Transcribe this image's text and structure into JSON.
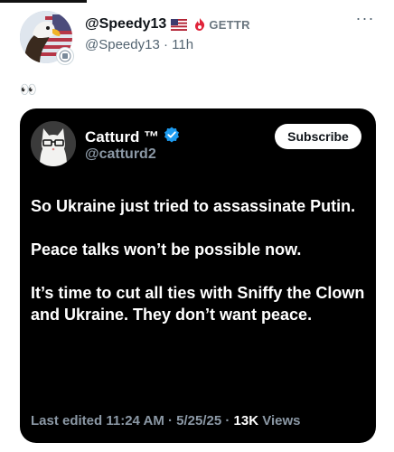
{
  "post": {
    "display_name": "@Speedy13",
    "flag_icon": "us-flag-icon",
    "source_label": "GETTR",
    "handle": "@Speedy13",
    "separator": "·",
    "time": "11h",
    "more_label": "···",
    "text": "👀"
  },
  "embed": {
    "name": "Catturd ™",
    "verified_icon": "verified-badge-icon",
    "verified_color": "#1d9bf0",
    "handle": "@catturd2",
    "subscribe_label": "Subscribe",
    "paragraphs": [
      "So Ukraine just tried to assassinate Putin.",
      "Peace talks won’t be possible now.",
      "It’s time to cut all ties with Sniffy the Clown and Ukraine. They don’t want peace."
    ],
    "footer": {
      "edited": "Last edited 11:24 AM · 5/25/25",
      "separator": " · ",
      "views_count": "13K",
      "views_label": " Views"
    }
  },
  "colors": {
    "gettr_accent": "#e0243a",
    "card_background": "#000000",
    "muted_text": "#536471"
  }
}
